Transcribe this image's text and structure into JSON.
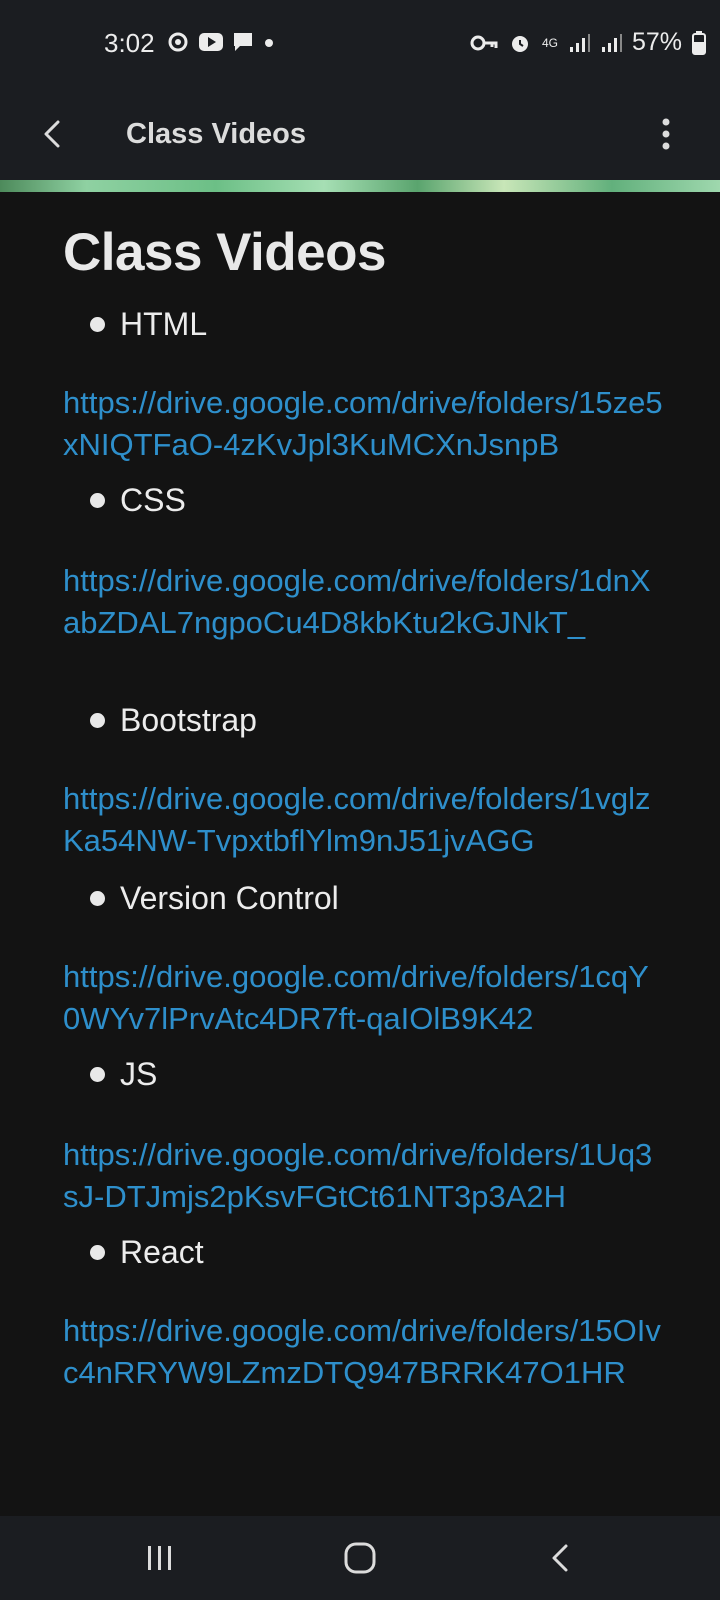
{
  "status_bar": {
    "time": "3:02",
    "battery_pct": "57%",
    "network": "4G"
  },
  "app_bar": {
    "title": "Class Videos"
  },
  "page": {
    "title": "Class Videos",
    "items": [
      {
        "label": "HTML",
        "url": "https://drive.google.com/drive/folders/15ze5xNIQTFaO-4zKvJpl3KuMCXnJsnpB"
      },
      {
        "label": "CSS",
        "url": "https://drive.google.com/drive/folders/1dnXabZDAL7ngpoCu4D8kbKtu2kGJNkT_"
      },
      {
        "label": "Bootstrap",
        "url": "https://drive.google.com/drive/folders/1vglzKa54NW-TvpxtbflYlm9nJ51jvAGG"
      },
      {
        "label": "Version Control",
        "url": "https://drive.google.com/drive/folders/1cqY0WYv7lPrvAtc4DR7ft-qaIOlB9K42"
      },
      {
        "label": "JS",
        "url": "https://drive.google.com/drive/folders/1Uq3sJ-DTJmjs2pKsvFGtCt61NT3p3A2H"
      },
      {
        "label": "React",
        "url": "https://drive.google.com/drive/folders/15OIvc4nRRYW9LZmzDTQ947BRRK47O1HR"
      }
    ]
  },
  "colors": {
    "link": "#2e8fcb",
    "background": "#131313",
    "bar": "#1b1d21"
  }
}
